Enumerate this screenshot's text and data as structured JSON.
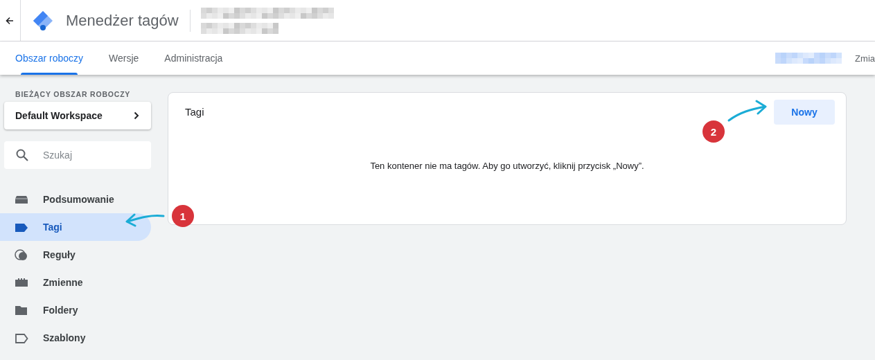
{
  "header": {
    "title": "Menedżer tagów"
  },
  "tabs": [
    {
      "label": "Obszar roboczy",
      "selected": true
    },
    {
      "label": "Wersje",
      "selected": false
    },
    {
      "label": "Administracja",
      "selected": false
    }
  ],
  "tabbar_right": {
    "text": "Zmia"
  },
  "sidebar": {
    "section_label": "BIEŻĄCY OBSZAR ROBOCZY",
    "workspace": "Default Workspace",
    "search": {
      "placeholder": "Szukaj"
    },
    "items": [
      {
        "label": "Podsumowanie",
        "selected": false
      },
      {
        "label": "Tagi",
        "selected": true
      },
      {
        "label": "Reguły",
        "selected": false
      },
      {
        "label": "Zmienne",
        "selected": false
      },
      {
        "label": "Foldery",
        "selected": false
      },
      {
        "label": "Szablony",
        "selected": false
      }
    ]
  },
  "card": {
    "title": "Tagi",
    "button": "Nowy",
    "message": "Ten kontener nie ma tagów. Aby go utworzyć, kliknij przycisk „Nowy”."
  },
  "annotations": [
    {
      "number": "1"
    },
    {
      "number": "2"
    }
  ]
}
